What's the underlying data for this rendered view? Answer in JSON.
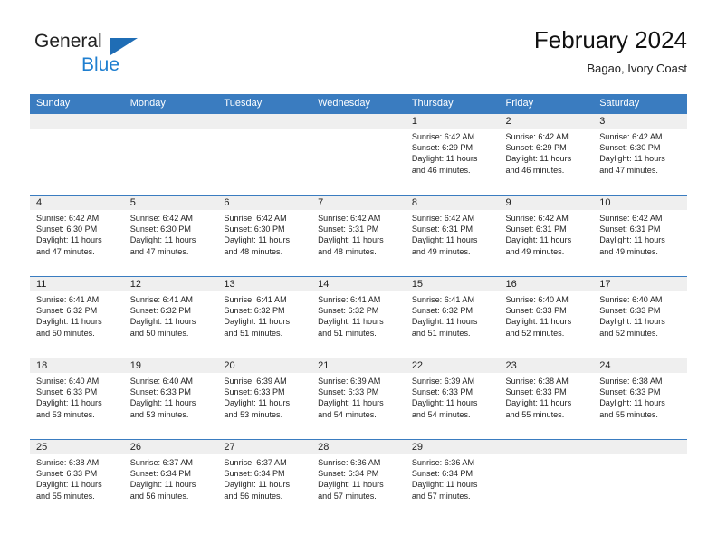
{
  "brand": {
    "name_top": "General",
    "name_bottom": "Blue",
    "accent_color": "#1f7fd0",
    "triangle_color": "#1f6db5"
  },
  "header": {
    "title": "February 2024",
    "subtitle": "Bagao, Ivory Coast"
  },
  "theme": {
    "header_blue": "#3a7cc0",
    "daynum_band": "#efefef",
    "text": "#232323"
  },
  "weekday_headers": [
    "Sunday",
    "Monday",
    "Tuesday",
    "Wednesday",
    "Thursday",
    "Friday",
    "Saturday"
  ],
  "weeks": [
    [
      {
        "day": "",
        "sunrise": "",
        "sunset": "",
        "daylight_line1": "",
        "daylight_line2": ""
      },
      {
        "day": "",
        "sunrise": "",
        "sunset": "",
        "daylight_line1": "",
        "daylight_line2": ""
      },
      {
        "day": "",
        "sunrise": "",
        "sunset": "",
        "daylight_line1": "",
        "daylight_line2": ""
      },
      {
        "day": "",
        "sunrise": "",
        "sunset": "",
        "daylight_line1": "",
        "daylight_line2": ""
      },
      {
        "day": "1",
        "sunrise": "Sunrise: 6:42 AM",
        "sunset": "Sunset: 6:29 PM",
        "daylight_line1": "Daylight: 11 hours",
        "daylight_line2": "and 46 minutes."
      },
      {
        "day": "2",
        "sunrise": "Sunrise: 6:42 AM",
        "sunset": "Sunset: 6:29 PM",
        "daylight_line1": "Daylight: 11 hours",
        "daylight_line2": "and 46 minutes."
      },
      {
        "day": "3",
        "sunrise": "Sunrise: 6:42 AM",
        "sunset": "Sunset: 6:30 PM",
        "daylight_line1": "Daylight: 11 hours",
        "daylight_line2": "and 47 minutes."
      }
    ],
    [
      {
        "day": "4",
        "sunrise": "Sunrise: 6:42 AM",
        "sunset": "Sunset: 6:30 PM",
        "daylight_line1": "Daylight: 11 hours",
        "daylight_line2": "and 47 minutes."
      },
      {
        "day": "5",
        "sunrise": "Sunrise: 6:42 AM",
        "sunset": "Sunset: 6:30 PM",
        "daylight_line1": "Daylight: 11 hours",
        "daylight_line2": "and 47 minutes."
      },
      {
        "day": "6",
        "sunrise": "Sunrise: 6:42 AM",
        "sunset": "Sunset: 6:30 PM",
        "daylight_line1": "Daylight: 11 hours",
        "daylight_line2": "and 48 minutes."
      },
      {
        "day": "7",
        "sunrise": "Sunrise: 6:42 AM",
        "sunset": "Sunset: 6:31 PM",
        "daylight_line1": "Daylight: 11 hours",
        "daylight_line2": "and 48 minutes."
      },
      {
        "day": "8",
        "sunrise": "Sunrise: 6:42 AM",
        "sunset": "Sunset: 6:31 PM",
        "daylight_line1": "Daylight: 11 hours",
        "daylight_line2": "and 49 minutes."
      },
      {
        "day": "9",
        "sunrise": "Sunrise: 6:42 AM",
        "sunset": "Sunset: 6:31 PM",
        "daylight_line1": "Daylight: 11 hours",
        "daylight_line2": "and 49 minutes."
      },
      {
        "day": "10",
        "sunrise": "Sunrise: 6:42 AM",
        "sunset": "Sunset: 6:31 PM",
        "daylight_line1": "Daylight: 11 hours",
        "daylight_line2": "and 49 minutes."
      }
    ],
    [
      {
        "day": "11",
        "sunrise": "Sunrise: 6:41 AM",
        "sunset": "Sunset: 6:32 PM",
        "daylight_line1": "Daylight: 11 hours",
        "daylight_line2": "and 50 minutes."
      },
      {
        "day": "12",
        "sunrise": "Sunrise: 6:41 AM",
        "sunset": "Sunset: 6:32 PM",
        "daylight_line1": "Daylight: 11 hours",
        "daylight_line2": "and 50 minutes."
      },
      {
        "day": "13",
        "sunrise": "Sunrise: 6:41 AM",
        "sunset": "Sunset: 6:32 PM",
        "daylight_line1": "Daylight: 11 hours",
        "daylight_line2": "and 51 minutes."
      },
      {
        "day": "14",
        "sunrise": "Sunrise: 6:41 AM",
        "sunset": "Sunset: 6:32 PM",
        "daylight_line1": "Daylight: 11 hours",
        "daylight_line2": "and 51 minutes."
      },
      {
        "day": "15",
        "sunrise": "Sunrise: 6:41 AM",
        "sunset": "Sunset: 6:32 PM",
        "daylight_line1": "Daylight: 11 hours",
        "daylight_line2": "and 51 minutes."
      },
      {
        "day": "16",
        "sunrise": "Sunrise: 6:40 AM",
        "sunset": "Sunset: 6:33 PM",
        "daylight_line1": "Daylight: 11 hours",
        "daylight_line2": "and 52 minutes."
      },
      {
        "day": "17",
        "sunrise": "Sunrise: 6:40 AM",
        "sunset": "Sunset: 6:33 PM",
        "daylight_line1": "Daylight: 11 hours",
        "daylight_line2": "and 52 minutes."
      }
    ],
    [
      {
        "day": "18",
        "sunrise": "Sunrise: 6:40 AM",
        "sunset": "Sunset: 6:33 PM",
        "daylight_line1": "Daylight: 11 hours",
        "daylight_line2": "and 53 minutes."
      },
      {
        "day": "19",
        "sunrise": "Sunrise: 6:40 AM",
        "sunset": "Sunset: 6:33 PM",
        "daylight_line1": "Daylight: 11 hours",
        "daylight_line2": "and 53 minutes."
      },
      {
        "day": "20",
        "sunrise": "Sunrise: 6:39 AM",
        "sunset": "Sunset: 6:33 PM",
        "daylight_line1": "Daylight: 11 hours",
        "daylight_line2": "and 53 minutes."
      },
      {
        "day": "21",
        "sunrise": "Sunrise: 6:39 AM",
        "sunset": "Sunset: 6:33 PM",
        "daylight_line1": "Daylight: 11 hours",
        "daylight_line2": "and 54 minutes."
      },
      {
        "day": "22",
        "sunrise": "Sunrise: 6:39 AM",
        "sunset": "Sunset: 6:33 PM",
        "daylight_line1": "Daylight: 11 hours",
        "daylight_line2": "and 54 minutes."
      },
      {
        "day": "23",
        "sunrise": "Sunrise: 6:38 AM",
        "sunset": "Sunset: 6:33 PM",
        "daylight_line1": "Daylight: 11 hours",
        "daylight_line2": "and 55 minutes."
      },
      {
        "day": "24",
        "sunrise": "Sunrise: 6:38 AM",
        "sunset": "Sunset: 6:33 PM",
        "daylight_line1": "Daylight: 11 hours",
        "daylight_line2": "and 55 minutes."
      }
    ],
    [
      {
        "day": "25",
        "sunrise": "Sunrise: 6:38 AM",
        "sunset": "Sunset: 6:33 PM",
        "daylight_line1": "Daylight: 11 hours",
        "daylight_line2": "and 55 minutes."
      },
      {
        "day": "26",
        "sunrise": "Sunrise: 6:37 AM",
        "sunset": "Sunset: 6:34 PM",
        "daylight_line1": "Daylight: 11 hours",
        "daylight_line2": "and 56 minutes."
      },
      {
        "day": "27",
        "sunrise": "Sunrise: 6:37 AM",
        "sunset": "Sunset: 6:34 PM",
        "daylight_line1": "Daylight: 11 hours",
        "daylight_line2": "and 56 minutes."
      },
      {
        "day": "28",
        "sunrise": "Sunrise: 6:36 AM",
        "sunset": "Sunset: 6:34 PM",
        "daylight_line1": "Daylight: 11 hours",
        "daylight_line2": "and 57 minutes."
      },
      {
        "day": "29",
        "sunrise": "Sunrise: 6:36 AM",
        "sunset": "Sunset: 6:34 PM",
        "daylight_line1": "Daylight: 11 hours",
        "daylight_line2": "and 57 minutes."
      },
      {
        "day": "",
        "sunrise": "",
        "sunset": "",
        "daylight_line1": "",
        "daylight_line2": ""
      },
      {
        "day": "",
        "sunrise": "",
        "sunset": "",
        "daylight_line1": "",
        "daylight_line2": ""
      }
    ]
  ]
}
